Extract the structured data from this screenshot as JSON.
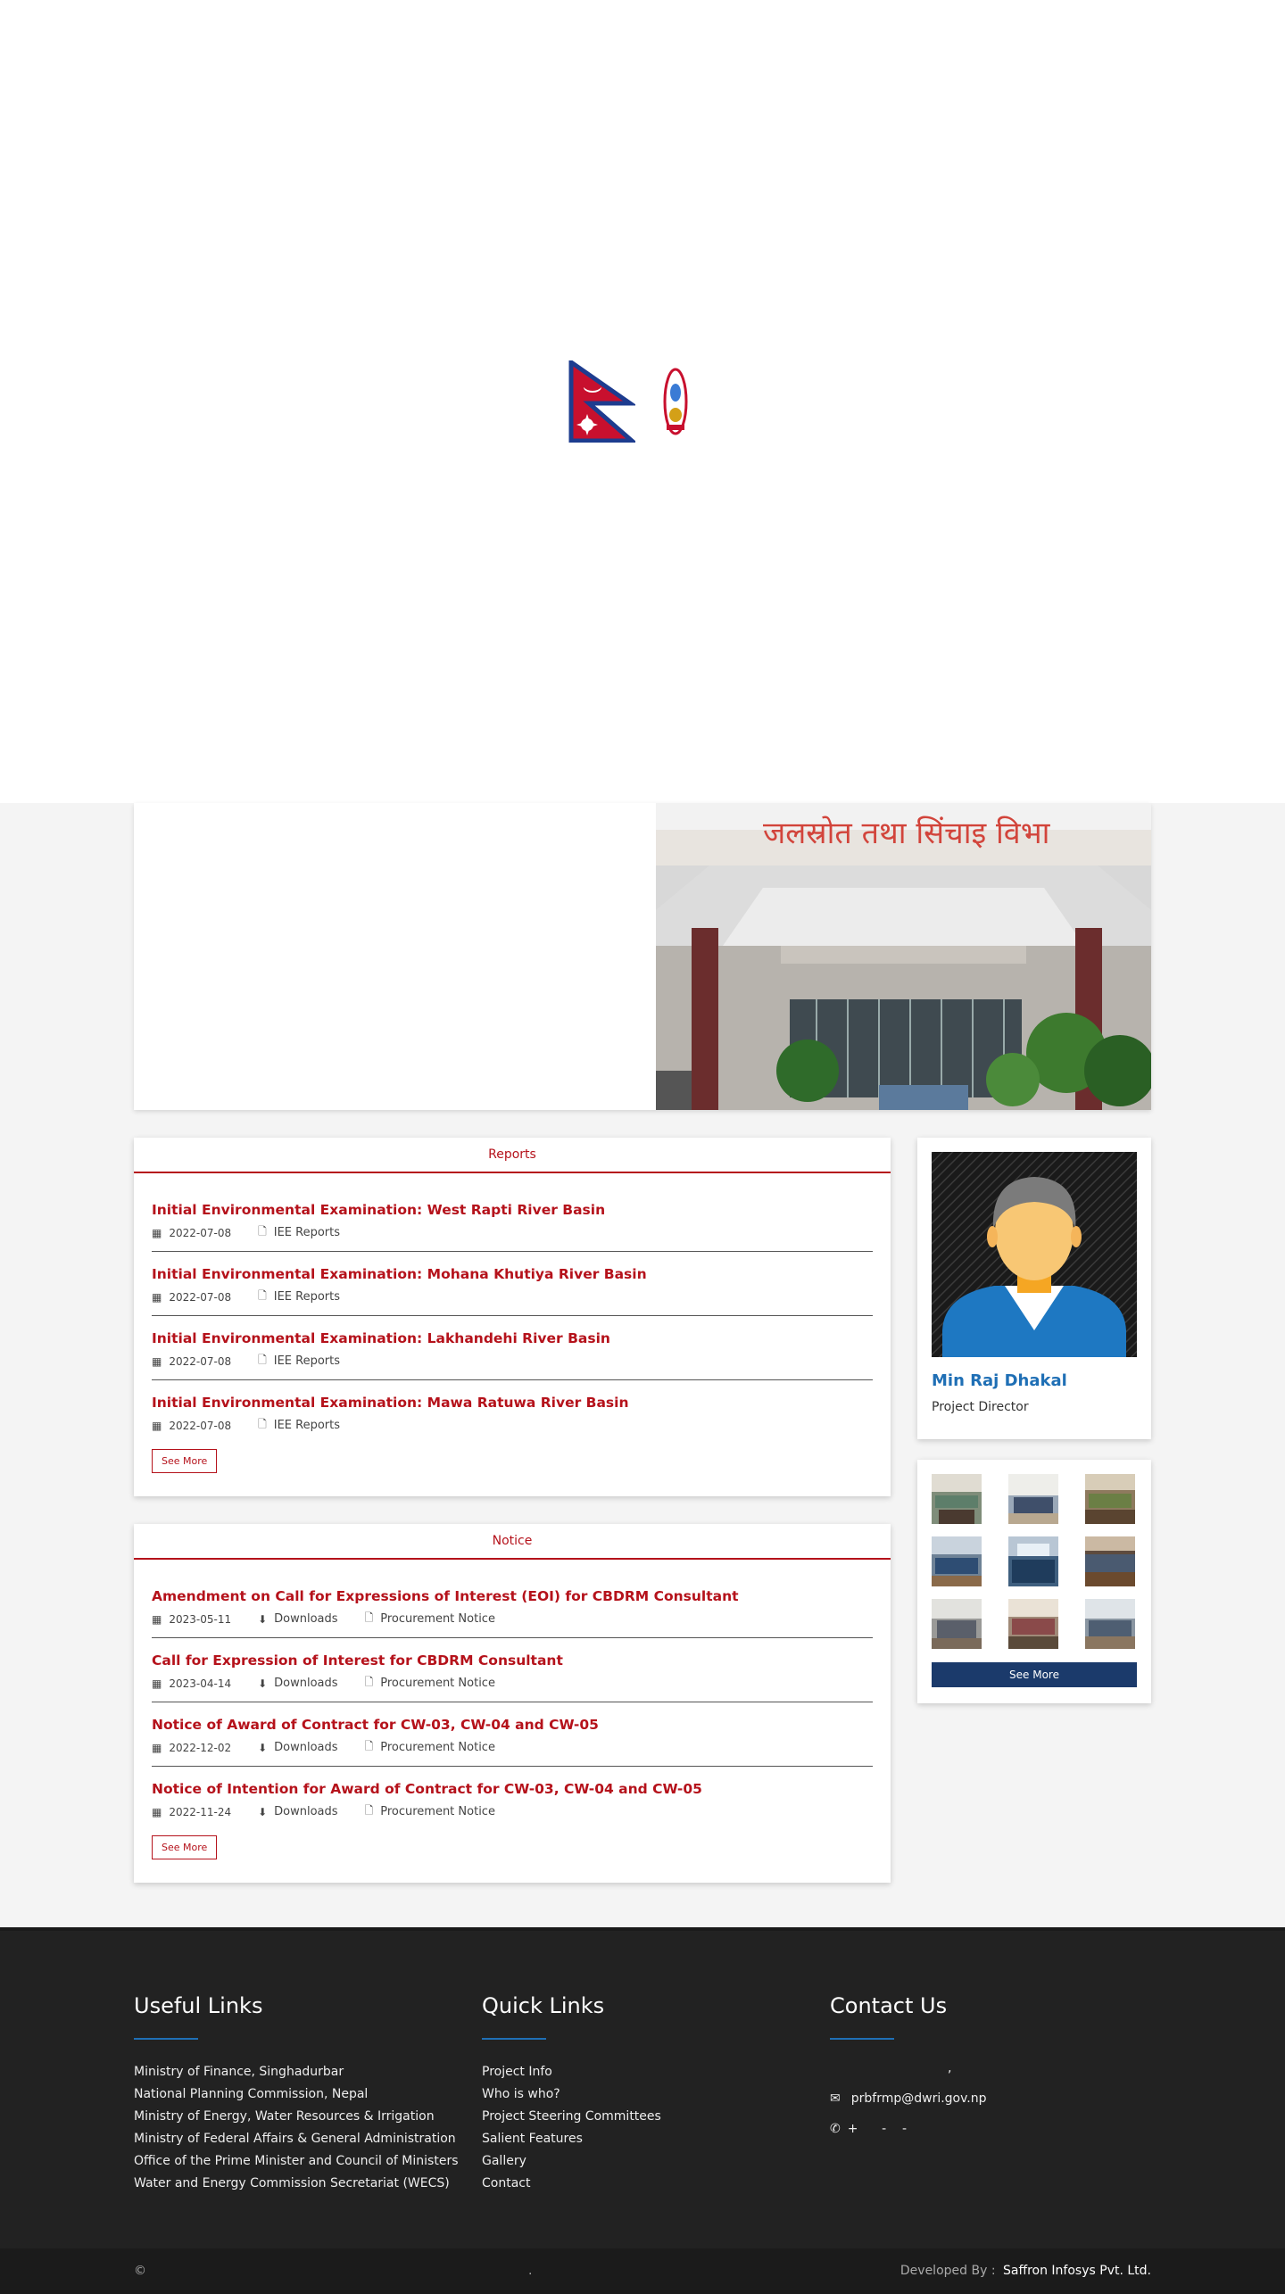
{
  "intro": {},
  "reports": {
    "heading": "Reports",
    "items": [
      {
        "title": "Initial Environmental Examination: West Rapti River Basin",
        "date": "2022-07-08",
        "category": "IEE Reports"
      },
      {
        "title": "Initial Environmental Examination: Mohana Khutiya River Basin",
        "date": "2022-07-08",
        "category": "IEE Reports"
      },
      {
        "title": "Initial Environmental Examination: Lakhandehi River Basin",
        "date": "2022-07-08",
        "category": "IEE Reports"
      },
      {
        "title": "Initial Environmental Examination: Mawa Ratuwa River Basin",
        "date": "2022-07-08",
        "category": "IEE Reports"
      }
    ],
    "see_more": "See More"
  },
  "notice": {
    "heading": "Notice",
    "items": [
      {
        "title": "Amendment on Call for Expressions of Interest (EOI) for CBDRM Consultant",
        "date": "2023-05-11",
        "downloads": "Downloads",
        "category": "Procurement Notice"
      },
      {
        "title": "Call for Expression of Interest for CBDRM Consultant",
        "date": "2023-04-14",
        "downloads": "Downloads",
        "category": "Procurement Notice"
      },
      {
        "title": "Notice of Award of Contract for CW-03, CW-04 and CW-05",
        "date": "2022-12-02",
        "downloads": "Downloads",
        "category": "Procurement Notice"
      },
      {
        "title": "Notice of Intention for Award of Contract for CW-03, CW-04 and CW-05",
        "date": "2022-11-24",
        "downloads": "Downloads",
        "category": "Procurement Notice"
      }
    ],
    "see_more": "See More"
  },
  "profile": {
    "name": "Min Raj Dhakal",
    "role": "Project Director"
  },
  "gallery": {
    "button": "See More"
  },
  "footer": {
    "useful_links": {
      "heading": "Useful Links",
      "links": [
        "Ministry of Finance, Singhadurbar",
        "National Planning Commission, Nepal",
        "Ministry of Energy, Water Resources & Irrigation",
        "Ministry of Federal Affairs & General Administration",
        "Office of the Prime Minister and Council of Ministers",
        "Water and Energy Commission Secretariat (WECS)"
      ]
    },
    "quick_links": {
      "heading": "Quick Links",
      "links": [
        "Project Info",
        "Who is who?",
        "Project Steering Committees",
        "Salient Features",
        "Gallery",
        "Contact"
      ]
    },
    "contact": {
      "heading": "Contact Us",
      "address": ",",
      "email": "prbfrmp@dwri.gov.np",
      "phone": "+      -    -"
    }
  },
  "bottom": {
    "copyright": "©",
    "middle": ".",
    "developed_by_label": "Developed By :",
    "developer": "Saffron Infosys Pvt. Ltd."
  },
  "colors": {
    "accent_red": "#b5121b",
    "link_blue": "#1f6fb5",
    "button_navy": "#1b3a6b",
    "footer_bg": "#222222"
  }
}
